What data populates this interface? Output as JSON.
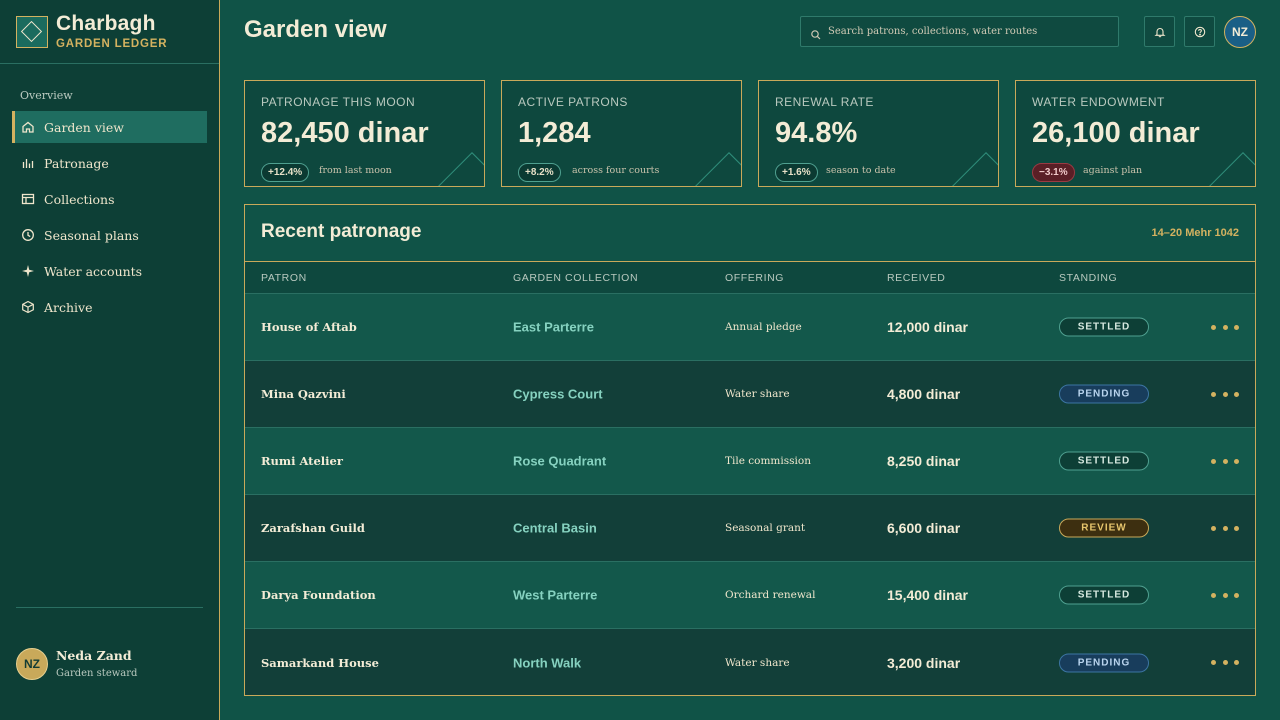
{
  "brand": {
    "name": "Charbagh",
    "subtitle": "GARDEN LEDGER"
  },
  "sidebar": {
    "section_label": "Overview",
    "items": [
      {
        "label": "Garden view",
        "icon": "home-icon",
        "active": true
      },
      {
        "label": "Patronage",
        "icon": "bar-chart-icon",
        "active": false
      },
      {
        "label": "Collections",
        "icon": "table-icon",
        "active": false
      },
      {
        "label": "Seasonal plans",
        "icon": "clock-icon",
        "active": false
      },
      {
        "label": "Water accounts",
        "icon": "sparkle-icon",
        "active": false
      },
      {
        "label": "Archive",
        "icon": "box-icon",
        "active": false
      }
    ]
  },
  "user": {
    "initials": "NZ",
    "name": "Neda Zand",
    "role": "Garden steward"
  },
  "header": {
    "title": "Garden view",
    "search_placeholder": "Search patrons, collections, water routes",
    "avatar_initials": "NZ",
    "icons": [
      "search-icon",
      "bell-icon",
      "help-icon"
    ]
  },
  "kpis": [
    {
      "label": "PATRONAGE THIS MOON",
      "value": "82,450 dinar",
      "change": "+12.4%",
      "note": "from last moon",
      "trend": "up"
    },
    {
      "label": "ACTIVE PATRONS",
      "value": "1,284",
      "change": "+8.2%",
      "note": "across four courts",
      "trend": "up"
    },
    {
      "label": "RENEWAL RATE",
      "value": "94.8%",
      "change": "+1.6%",
      "note": "season to date",
      "trend": "up"
    },
    {
      "label": "WATER ENDOWMENT",
      "value": "26,100 dinar",
      "change": "−3.1%",
      "note": "against plan",
      "trend": "down"
    }
  ],
  "table": {
    "title": "Recent patronage",
    "date_range": "14–20 Mehr 1042",
    "columns": [
      "PATRON",
      "GARDEN COLLECTION",
      "OFFERING",
      "RECEIVED",
      "STANDING"
    ],
    "rows": [
      {
        "patron": "House of Aftab",
        "collection": "East Parterre",
        "offering": "Annual pledge",
        "received": "12,000 dinar",
        "standing": "SETTLED"
      },
      {
        "patron": "Mina Qazvini",
        "collection": "Cypress Court",
        "offering": "Water share",
        "received": "4,800 dinar",
        "standing": "PENDING"
      },
      {
        "patron": "Rumi Atelier",
        "collection": "Rose Quadrant",
        "offering": "Tile commission",
        "received": "8,250 dinar",
        "standing": "SETTLED"
      },
      {
        "patron": "Zarafshan Guild",
        "collection": "Central Basin",
        "offering": "Seasonal grant",
        "received": "6,600 dinar",
        "standing": "REVIEW"
      },
      {
        "patron": "Darya Foundation",
        "collection": "West Parterre",
        "offering": "Orchard renewal",
        "received": "15,400 dinar",
        "standing": "SETTLED"
      },
      {
        "patron": "Samarkand House",
        "collection": "North Walk",
        "offering": "Water share",
        "received": "3,200 dinar",
        "standing": "PENDING"
      }
    ]
  },
  "colors": {
    "background": "#105347",
    "sidebar": "#0d3f36",
    "accent_gold": "#d4b260",
    "collection_teal": "#86d2c0",
    "negative": "#5a1f26"
  }
}
